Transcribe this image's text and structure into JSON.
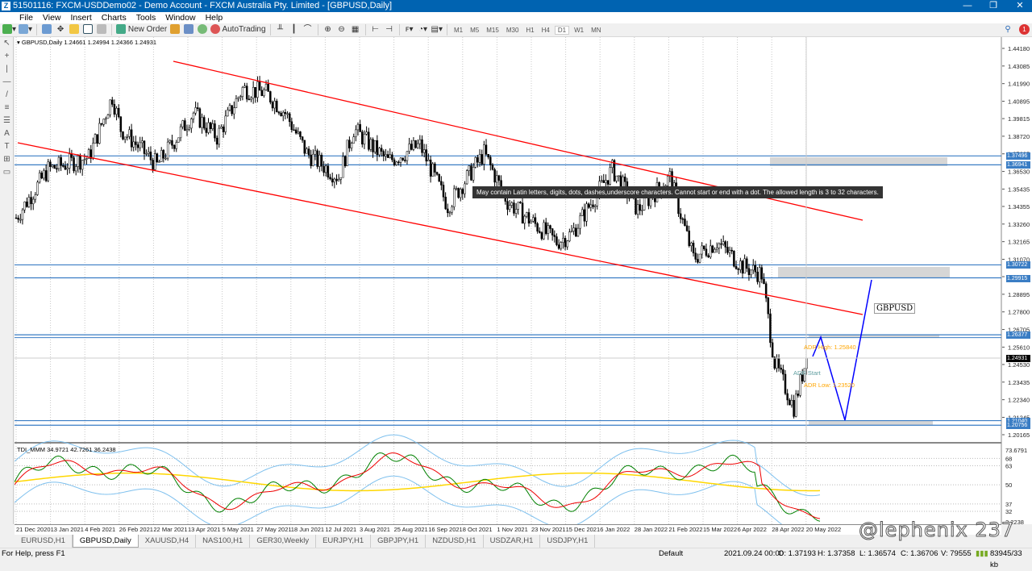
{
  "window": {
    "title": "51501116: FXCM-USDDemo02 - Demo Account - FXCM Australia Pty. Limited - [GBPUSD,Daily]",
    "logo": "Z"
  },
  "menu": [
    "File",
    "View",
    "Insert",
    "Charts",
    "Tools",
    "Window",
    "Help"
  ],
  "toolbar": {
    "new_order": "New Order",
    "autotrading": "AutoTrading",
    "timeframes": [
      "M1",
      "M5",
      "M15",
      "M30",
      "H1",
      "H4",
      "D1",
      "W1",
      "MN"
    ],
    "active_timeframe": "D1"
  },
  "chart": {
    "header": "GBPUSD,Daily  1.24661 1.24994 1.24366 1.24931",
    "symbol_label": "GBPUSD",
    "tooltip": "May contain Latin letters, digits, dots, dashes,underscore characters. Cannot start or end with a dot. The allowed length is 3 to 32 characters.",
    "adr_high": "ADR High: 1.25840",
    "adr_start": "ADR Start",
    "adr_low": "ADR Low: 1.23520",
    "price_ticks": [
      "1.44180",
      "1.43085",
      "1.41990",
      "1.40895",
      "1.39815",
      "1.38720",
      "1.37625",
      "1.36530",
      "1.35435",
      "1.34355",
      "1.33260",
      "1.32165",
      "1.31070",
      "1.29990",
      "1.28895",
      "1.27800",
      "1.26705",
      "1.25610",
      "1.24530",
      "1.23435",
      "1.22340",
      "1.21245",
      "1.20165"
    ],
    "price_tags": [
      "1.37496",
      "1.36941",
      "1.30722",
      "1.29915",
      "1.26377",
      "1.21040",
      "1.20756"
    ],
    "current_price": "1.24931",
    "price_path": [
      [
        0,
        1.3365
      ],
      [
        15,
        1.3666
      ],
      [
        34,
        1.3741
      ],
      [
        45,
        1.4117
      ],
      [
        49,
        1.3917
      ],
      [
        66,
        1.3691
      ],
      [
        83,
        1.4017
      ],
      [
        94,
        1.3867
      ],
      [
        106,
        1.4167
      ],
      [
        117,
        1.4142
      ],
      [
        126,
        1.4017
      ],
      [
        136,
        1.3766
      ],
      [
        151,
        1.3616
      ],
      [
        158,
        1.3917
      ],
      [
        174,
        1.3716
      ],
      [
        189,
        1.3816
      ],
      [
        202,
        1.344
      ],
      [
        219,
        1.3766
      ],
      [
        230,
        1.3465
      ],
      [
        253,
        1.3215
      ],
      [
        260,
        1.3265
      ],
      [
        279,
        1.3666
      ],
      [
        291,
        1.3415
      ],
      [
        306,
        1.3616
      ],
      [
        317,
        1.3114
      ],
      [
        328,
        1.3215
      ],
      [
        340,
        1.3064
      ],
      [
        349,
        1.3014
      ],
      [
        355,
        1.2463
      ],
      [
        364,
        1.2187
      ],
      [
        370,
        1.2493
      ]
    ],
    "dates": [
      "21 Dec 2020",
      "13 Jan 2021",
      "4 Feb 2021",
      "26 Feb 2021",
      "22 Mar 2021",
      "13 Apr 2021",
      "5 May 2021",
      "27 May 2021",
      "18 Jun 2021",
      "12 Jul 2021",
      "3 Aug 2021",
      "25 Aug 2021",
      "16 Sep 2021",
      "8 Oct 2021",
      "1 Nov 2021",
      "23 Nov 2021",
      "15 Dec 2021",
      "6 Jan 2022",
      "28 Jan 2022",
      "21 Feb 2022",
      "15 Mar 2022",
      "6 Apr 2022",
      "28 Apr 2022",
      "20 May 2022"
    ]
  },
  "indicator": {
    "header": "TDI_MMM 34.9721 42.7261 36.2438",
    "ticks": [
      "73.6791",
      "68",
      "63",
      "50",
      "37",
      "32"
    ],
    "bottom_tick": "2.2238"
  },
  "tabs": [
    "EURUSD,H1",
    "GBPUSD,Daily",
    "XAUUSD,H4",
    "NAS100,H1",
    "GER30,Weekly",
    "EURJPY,H1",
    "GBPJPY,H1",
    "NZDUSD,H1",
    "USDZAR,H1",
    "USDJPY,H1"
  ],
  "active_tab": "GBPUSD,Daily",
  "watermark": "@lephenix 237",
  "status": {
    "help": "For Help, press F1",
    "profile": "Default",
    "time": "2021.09.24 00:00",
    "open": "O: 1.37193",
    "high": "H: 1.37358",
    "low": "L: 1.36574",
    "close": "C: 1.36706",
    "volume": "V: 79555",
    "traffic": "83945/33 kb"
  },
  "colors": {
    "bull": "#000000",
    "trend": "#ff0000",
    "hline": "#3a7dc4",
    "blue_path": "#0000ff",
    "adr": "#ffa500",
    "adr_start": "#5f9ea0"
  }
}
